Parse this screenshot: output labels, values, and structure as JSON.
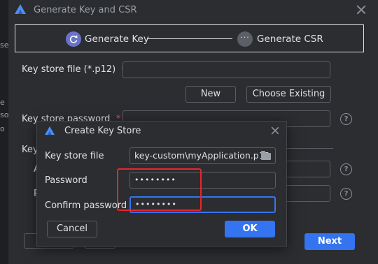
{
  "background_fragments": [
    "se",
    "e",
    "so",
    "o"
  ],
  "main_dialog": {
    "title": "Generate Key and CSR",
    "steps": [
      {
        "label": "Generate Key",
        "active": true
      },
      {
        "label": "Generate CSR",
        "active": false,
        "icon_text": "···"
      }
    ],
    "key_store_file_label": "Key store file (*.p12)",
    "key_store_password_label": "Key store password",
    "key_label_fragment": "Key",
    "alias_fragment": "A",
    "password_fragment": "P",
    "required_mark": "*",
    "new_button": "New",
    "choose_existing_button": "Choose Existing",
    "help_symbol": "?",
    "next_button": "Next"
  },
  "modal": {
    "title": "Create Key Store",
    "key_store_file_label": "Key store file",
    "key_store_file_value": "key-custom\\myApplication.p12",
    "password_label": "Password",
    "password_value": "••••••••",
    "confirm_password_label": "Confirm password",
    "confirm_password_value": "••••••••",
    "cancel_button": "Cancel",
    "ok_button": "OK"
  },
  "colors": {
    "background": "#2b2d30",
    "accent": "#3574f0",
    "step_active": "#6a72c9",
    "highlight": "#e8262a",
    "required": "#d9534f"
  },
  "icons": [
    "app-logo-icon",
    "close-icon",
    "refresh-icon",
    "folder-icon",
    "help-icon"
  ]
}
